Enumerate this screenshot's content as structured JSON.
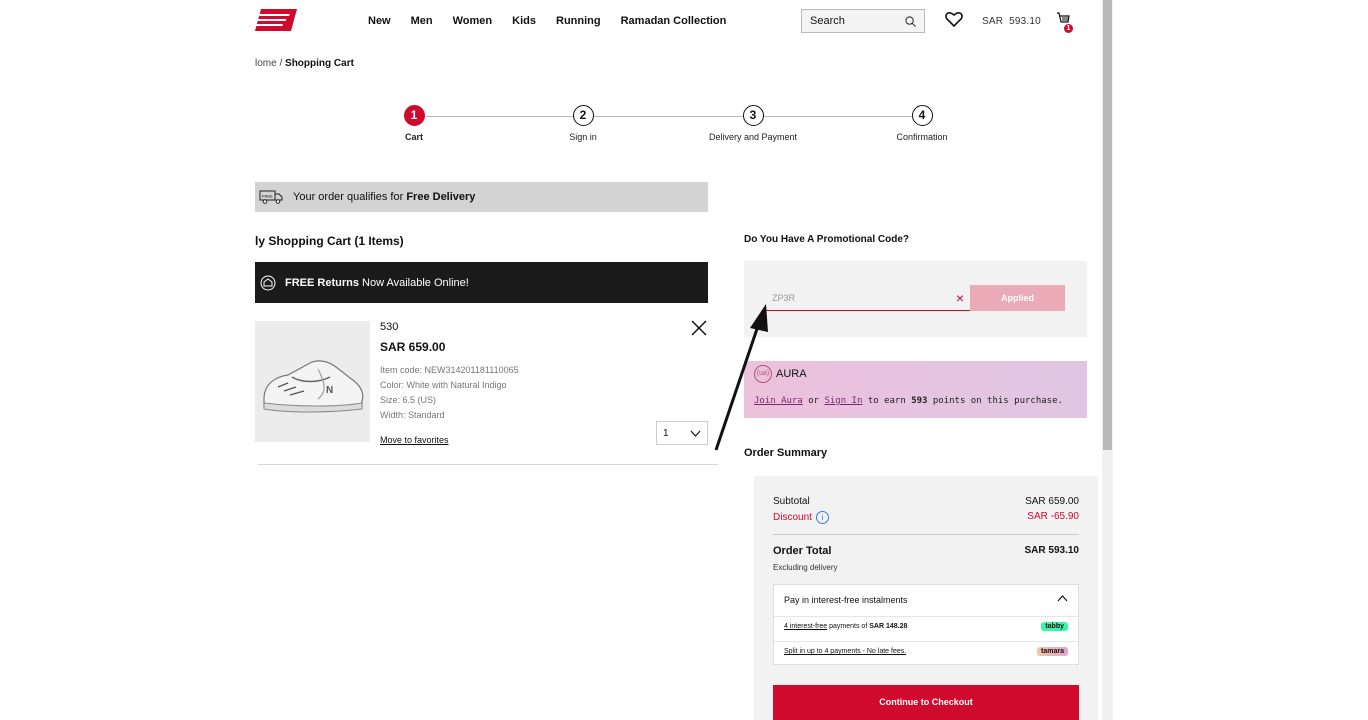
{
  "header": {
    "nav": [
      "New",
      "Men",
      "Women",
      "Kids",
      "Running",
      "Ramadan Collection"
    ],
    "search_placeholder": "Search",
    "currency": "SAR",
    "cart_total": "593.10",
    "cart_count": "1"
  },
  "breadcrumb": {
    "home": "lome",
    "separator": " / ",
    "current": "Shopping Cart"
  },
  "steps": [
    {
      "num": "1",
      "label": "Cart"
    },
    {
      "num": "2",
      "label": "Sign in"
    },
    {
      "num": "3",
      "label": "Delivery and Payment"
    },
    {
      "num": "4",
      "label": "Confirmation"
    }
  ],
  "free_delivery": {
    "text": "Your order qualifies for ",
    "bold": "Free Delivery"
  },
  "cart_title": "ly Shopping Cart (1 Items)",
  "returns": {
    "bold": "FREE Returns",
    "text": " Now Available Online!"
  },
  "product": {
    "name": "530",
    "price": "SAR  659.00",
    "item_code": "Item code: NEW314201181110065",
    "color": "Color: White with Natural Indigo",
    "size": "Size: 6.5 (US)",
    "width": "Width: Standard",
    "move_fav": "Move to favorites",
    "qty": "1"
  },
  "promo": {
    "title": "Do You Have A Promotional Code?",
    "code": "ZP3R",
    "applied": "Applied"
  },
  "aura": {
    "brand": "AURA",
    "logo_text": "(ua)",
    "join": "Join Aura",
    "or": " or ",
    "signin": "Sign In",
    "earn_pre": " to earn ",
    "points": "593",
    "earn_post": " points on this purchase."
  },
  "summary": {
    "title": "Order Summary",
    "subtotal_label": "Subtotal",
    "subtotal_value": "SAR 659.00",
    "discount_label": "Discount",
    "discount_value": "SAR -65.90",
    "total_label": "Order Total",
    "total_value": "SAR 593.10",
    "total_sub": "Excluding delivery"
  },
  "installments": {
    "title": "Pay in interest-free instalments",
    "tabby_link": "4 interest-free",
    "tabby_text": " payments of ",
    "tabby_amount": "SAR 148.28",
    "tabby_badge": "tabby",
    "tamara_link": "Split in up to 4 payments - No late fees.",
    "tamara_badge": "tamara"
  },
  "checkout_label": "Continue to Checkout",
  "colors": {
    "brand_red": "#cf0a2c",
    "banner_black": "#1a1a1a",
    "aura_pink": "#ecc1dc"
  }
}
